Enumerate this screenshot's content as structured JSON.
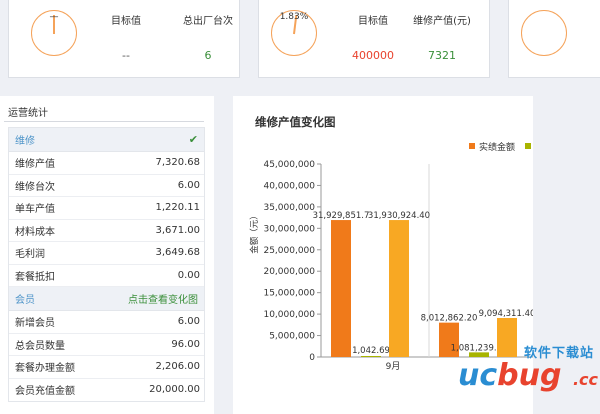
{
  "kpi_cards": [
    {
      "gauge_percent": "—",
      "items": [
        {
          "label": "目标值",
          "value": "--",
          "color": "#555555"
        },
        {
          "label": "总出厂台次",
          "value": "6",
          "color": "#3a8f3a"
        }
      ]
    },
    {
      "gauge_percent": "1.83%",
      "items": [
        {
          "label": "目标值",
          "value": "400000",
          "color": "#e8432e"
        },
        {
          "label": "维修产值(元)",
          "value": "7321",
          "color": "#3a8f3a"
        }
      ]
    }
  ],
  "stats": {
    "title": "运营统计",
    "repair_header": "维修",
    "repair_rows": [
      {
        "label": "维修产值",
        "value": "7,320.68"
      },
      {
        "label": "维修台次",
        "value": "6.00"
      },
      {
        "label": "单车产值",
        "value": "1,220.11"
      },
      {
        "label": "材料成本",
        "value": "3,671.00"
      },
      {
        "label": "毛利润",
        "value": "3,649.68"
      },
      {
        "label": "套餐抵扣",
        "value": "0.00"
      }
    ],
    "member_header": "会员",
    "member_link": "点击查看变化图",
    "member_rows": [
      {
        "label": "新增会员",
        "value": "6.00"
      },
      {
        "label": "总会员数量",
        "value": "96.00"
      },
      {
        "label": "套餐办理金额",
        "value": "2,206.00"
      },
      {
        "label": "会员充值金额",
        "value": "20,000.00"
      }
    ]
  },
  "chart_panel": {
    "title": "维修产值变化图"
  },
  "chart_data": {
    "type": "bar",
    "ylabel": "金额（元）",
    "ylim": [
      0,
      45000000
    ],
    "yticks": [
      "0",
      "5,000,000",
      "10,000,000",
      "15,000,000",
      "20,000,000",
      "25,000,000",
      "30,000,000",
      "35,000,000",
      "40,000,000",
      "45,000,000"
    ],
    "categories": [
      "9月",
      ""
    ],
    "grid": "vertical",
    "legend": "top-right",
    "series": [
      {
        "name": "实绩金额",
        "color": "#f07a1a",
        "values": [
          31929851.7,
          8012862.2
        ],
        "labels": [
          "31,929,851.7",
          "8,012,862.20"
        ]
      },
      {
        "name": "",
        "color": "#a8b400",
        "values": [
          1042.69,
          1081239.2
        ],
        "labels": [
          "1,042.69",
          "1,081,239.20"
        ]
      },
      {
        "name": "",
        "color": "#f8a823",
        "values": [
          31930924.4,
          9094311.4
        ],
        "labels": [
          "31,930,924.40",
          "9,094,311.40"
        ]
      }
    ]
  },
  "watermark": {
    "chinese": "软件下载站",
    "logo_a": "uc",
    "logo_b": "bug",
    "suffix": ".cc"
  }
}
